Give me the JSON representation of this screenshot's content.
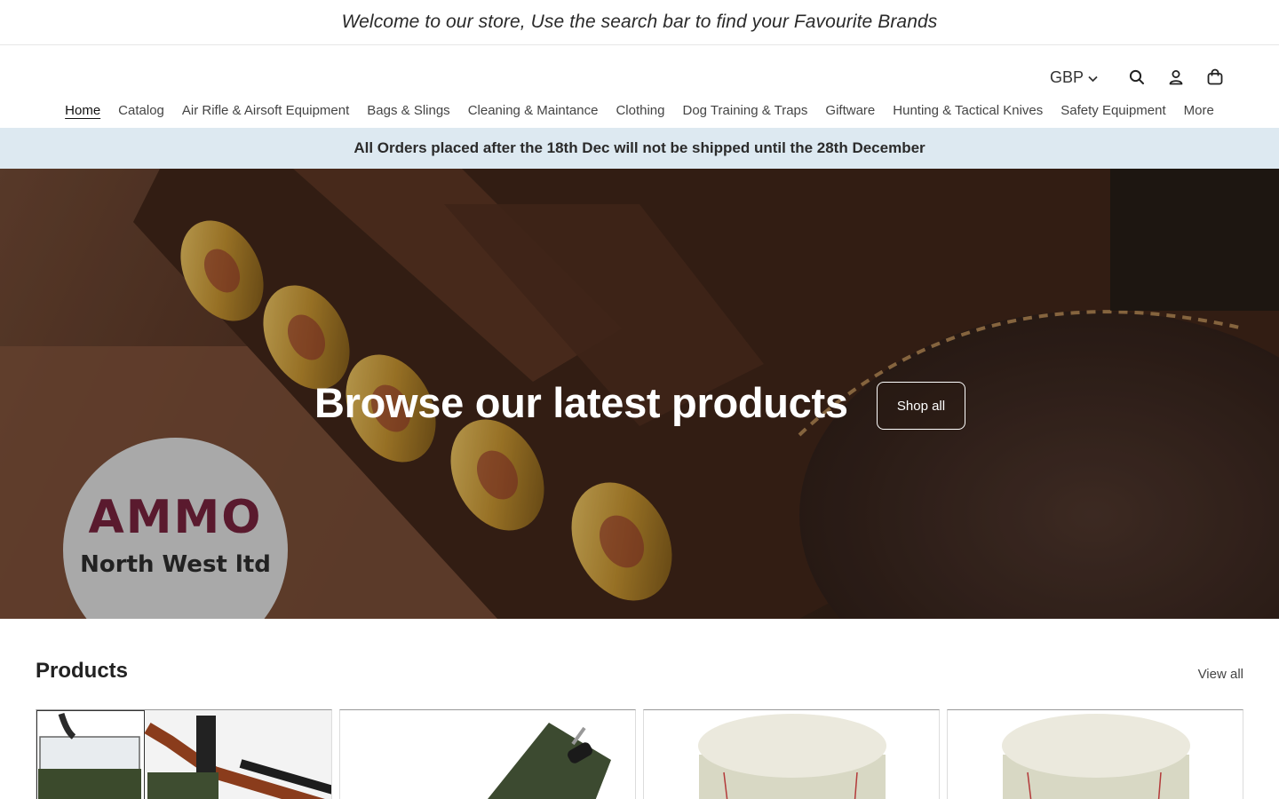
{
  "announcement": "Welcome to our store, Use the search bar to find your Favourite Brands",
  "header": {
    "currency": "GBP",
    "icons": [
      "search-icon",
      "account-icon",
      "cart-icon"
    ]
  },
  "nav": {
    "items": [
      {
        "label": "Home"
      },
      {
        "label": "Catalog"
      },
      {
        "label": "Air Rifle & Airsoft Equipment"
      },
      {
        "label": "Bags & Slings"
      },
      {
        "label": "Cleaning & Maintance"
      },
      {
        "label": "Clothing"
      },
      {
        "label": "Dog Training & Traps"
      },
      {
        "label": "Giftware"
      },
      {
        "label": "Hunting & Tactical Knives"
      },
      {
        "label": "Safety Equipment"
      },
      {
        "label": "More"
      }
    ]
  },
  "notice": "All Orders placed after the 18th Dec will not be shipped until the 28th December",
  "hero": {
    "title": "Browse our latest products",
    "button": "Shop all",
    "logo": {
      "line1": "AMMO",
      "line2": "North West ltd"
    }
  },
  "products": {
    "title": "Products",
    "view_all": "View all"
  },
  "colors": {
    "notice_bg": "#dde9f1",
    "logo_text": "#5a1a2e"
  }
}
